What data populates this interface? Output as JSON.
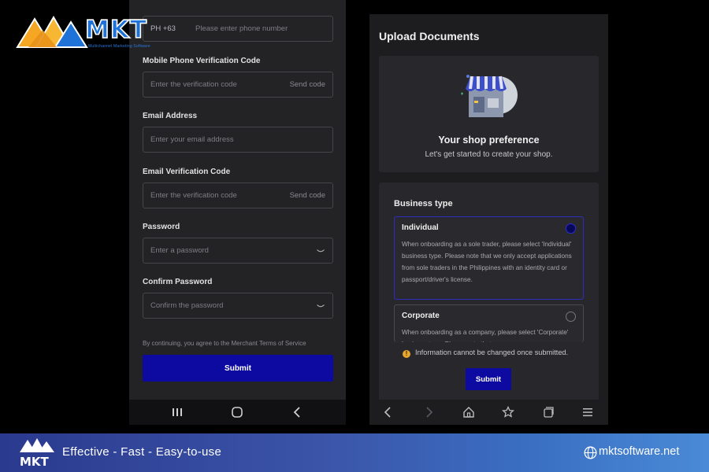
{
  "brand": {
    "name": "MKT",
    "subtitle": "Multichannel Marketing Software",
    "colors": {
      "primary_blue": "#1f73d8",
      "orange": "#f5a623",
      "submit_blue": "#0c0aa0"
    }
  },
  "signup_form": {
    "phone": {
      "prefix": "PH +63",
      "placeholder": "Please enter phone number"
    },
    "mobile_code": {
      "label": "Mobile Phone Verification Code",
      "placeholder": "Enter the verification code",
      "action": "Send code"
    },
    "email": {
      "label": "Email Address",
      "placeholder": "Enter your email address"
    },
    "email_code": {
      "label": "Email Verification Code",
      "placeholder": "Enter the verification code",
      "action": "Send code"
    },
    "password": {
      "label": "Password",
      "placeholder": "Enter a password"
    },
    "confirm_password": {
      "label": "Confirm Password",
      "placeholder": "Confirm the password"
    },
    "terms_text": "By continuing, you agree to the Merchant Terms of Service",
    "submit_label": "Submit"
  },
  "upload_documents": {
    "title": "Upload Documents",
    "shop_card": {
      "heading": "Your shop preference",
      "subtext": "Let's get started to create your shop."
    },
    "business_type": {
      "label": "Business type",
      "options": [
        {
          "name": "Individual",
          "selected": true,
          "description": "When onboarding as a sole trader, please select 'Individual' business type. Please note that we only accept applications from sole traders in the Philippines with an identity card or passport/driver's license."
        },
        {
          "name": "Corporate",
          "selected": false,
          "description": "When onboarding as a company, please select 'Corporate' business type. Please note that company"
        }
      ]
    },
    "note": "Information cannot be changed once submitted.",
    "submit_label": "Submit"
  },
  "android_nav": {
    "icons": [
      "recent-apps-icon",
      "home-circle-icon",
      "back-chevron-icon"
    ]
  },
  "browser_nav": {
    "icons": [
      "back-icon",
      "forward-icon",
      "home-icon",
      "bookmark-star-icon",
      "tabs-icon",
      "menu-icon"
    ]
  },
  "banner": {
    "brand": "MKT",
    "tagline": "Effective - Fast - Easy-to-use",
    "website": "mktsoftware.net"
  }
}
